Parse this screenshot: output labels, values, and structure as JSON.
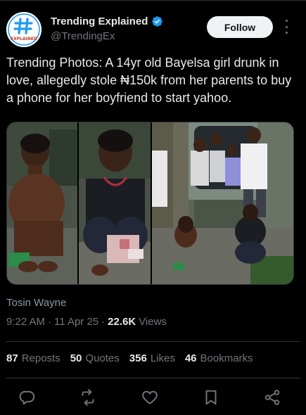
{
  "account": {
    "display_name": "Trending Explained",
    "handle": "@TrendingEx",
    "avatar_text": "EXPLAINED"
  },
  "follow_button": {
    "label": "Follow"
  },
  "tweet": {
    "text": "Trending Photos: A 14yr old Bayelsa girl drunk in love, allegedly stole ₦150k from her parents to buy a phone for her boyfriend to start yahoo.",
    "photo_count": 3
  },
  "credit": "Tosin Wayne",
  "meta": {
    "time": "9:22 AM",
    "separator1": "·",
    "date": "11 Apr 25",
    "separator2": "·",
    "views_count": "22.6K",
    "views_label": "Views"
  },
  "stats": [
    {
      "count": "87",
      "label": "Reposts"
    },
    {
      "count": "50",
      "label": "Quotes"
    },
    {
      "count": "356",
      "label": "Likes"
    },
    {
      "count": "46",
      "label": "Bookmarks"
    }
  ],
  "colors": {
    "background": "#000000",
    "text_primary": "#e7e9ea",
    "text_secondary": "#71767b",
    "verified_blue": "#1d9bf0",
    "divider": "#2f3336"
  },
  "actions": [
    "reply-icon",
    "repost-icon",
    "like-icon",
    "bookmark-icon",
    "share-icon"
  ]
}
